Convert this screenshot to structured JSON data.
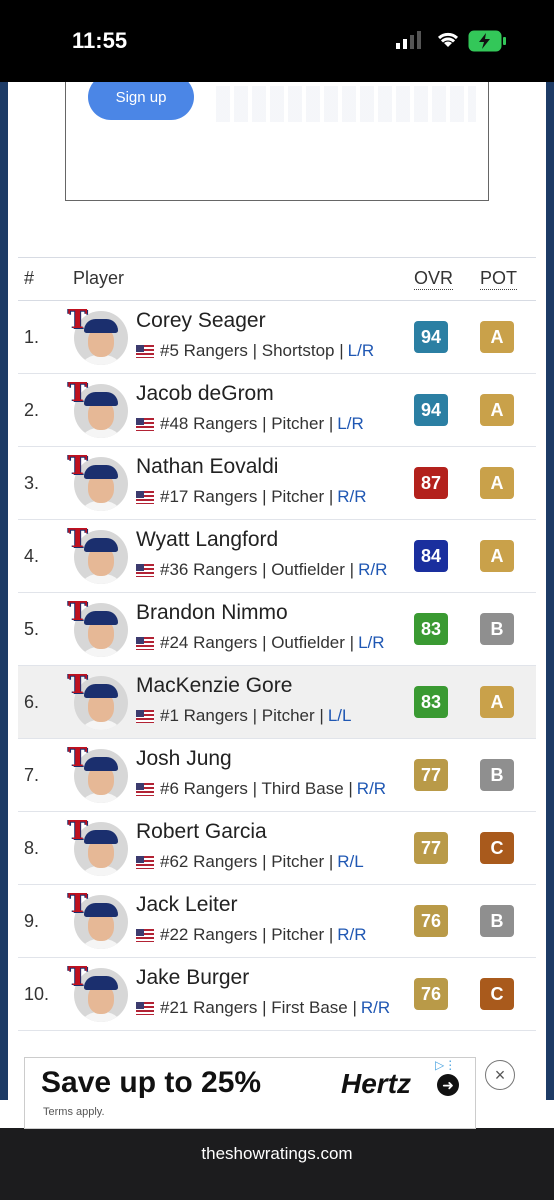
{
  "status_bar": {
    "time": "11:55"
  },
  "ad_top": {
    "signup_label": "Sign up"
  },
  "table": {
    "headers": {
      "num": "#",
      "player": "Player",
      "ovr": "OVR",
      "pot": "POT"
    },
    "rows": [
      {
        "rank": "1.",
        "name": "Corey Seager",
        "info": "#5 Rangers | Shortstop |",
        "hand": "L/R",
        "ovr": "94",
        "ovr_color": "#2b7fa3",
        "pot": "A",
        "pot_color": "#c9a14a"
      },
      {
        "rank": "2.",
        "name": "Jacob deGrom",
        "info": "#48 Rangers | Pitcher |",
        "hand": "L/R",
        "ovr": "94",
        "ovr_color": "#2b7fa3",
        "pot": "A",
        "pot_color": "#c9a14a"
      },
      {
        "rank": "3.",
        "name": "Nathan Eovaldi",
        "info": "#17 Rangers | Pitcher |",
        "hand": "R/R",
        "ovr": "87",
        "ovr_color": "#b3211c",
        "pot": "A",
        "pot_color": "#c9a14a"
      },
      {
        "rank": "4.",
        "name": "Wyatt Langford",
        "info": "#36 Rangers | Outfielder |",
        "hand": "R/R",
        "ovr": "84",
        "ovr_color": "#1a2f9e",
        "pot": "A",
        "pot_color": "#c9a14a"
      },
      {
        "rank": "5.",
        "name": "Brandon Nimmo",
        "info": "#24 Rangers | Outfielder |",
        "hand": "L/R",
        "ovr": "83",
        "ovr_color": "#3a9a32",
        "pot": "B",
        "pot_color": "#8f8f8f"
      },
      {
        "rank": "6.",
        "name": "MacKenzie Gore",
        "info": "#1 Rangers | Pitcher |",
        "hand": "L/L",
        "ovr": "83",
        "ovr_color": "#3a9a32",
        "pot": "A",
        "pot_color": "#c9a14a"
      },
      {
        "rank": "7.",
        "name": "Josh Jung",
        "info": "#6 Rangers | Third Base |",
        "hand": "R/R",
        "ovr": "77",
        "ovr_color": "#b99a48",
        "pot": "B",
        "pot_color": "#8f8f8f"
      },
      {
        "rank": "8.",
        "name": "Robert Garcia",
        "info": "#62 Rangers | Pitcher |",
        "hand": "R/L",
        "ovr": "77",
        "ovr_color": "#b99a48",
        "pot": "C",
        "pot_color": "#a95a1c"
      },
      {
        "rank": "9.",
        "name": "Jack Leiter",
        "info": "#22 Rangers | Pitcher |",
        "hand": "R/R",
        "ovr": "76",
        "ovr_color": "#b99a48",
        "pot": "B",
        "pot_color": "#8f8f8f"
      },
      {
        "rank": "10.",
        "name": "Jake Burger",
        "info": "#21 Rangers | First Base |",
        "hand": "R/R",
        "ovr": "76",
        "ovr_color": "#b99a48",
        "pot": "C",
        "pot_color": "#a95a1c"
      }
    ]
  },
  "ad_bottom": {
    "headline": "Save up to 25%",
    "terms": "Terms apply.",
    "brand": "Hertz",
    "close_label": "×"
  },
  "browser": {
    "url": "theshowratings.com"
  },
  "colors": {
    "alt_row": "#f0f0f0",
    "side": "#1d3b66",
    "signup": "#4b86e6"
  }
}
